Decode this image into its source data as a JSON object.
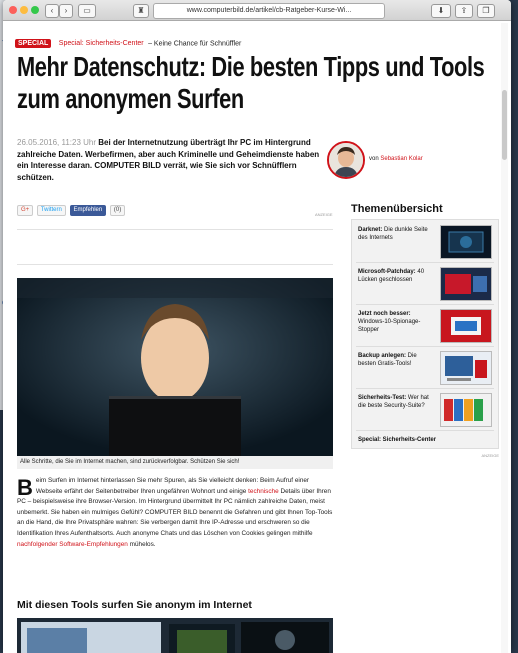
{
  "browser": {
    "url": "www.computerbild.de/artikel/cb-Ratgeber-Kurse-Wi..."
  },
  "background_window": {
    "cut_text": "Yo",
    "cut_text2": "CB"
  },
  "page": {
    "special_badge": "SPECIAL",
    "special_link": "Special: Sicherheits-Center",
    "special_suffix": "– Keine Chance für Schnüffler",
    "title": "Mehr Datenschutz: Die besten Tipps und Tools zum anonymen Surfen",
    "date": "26.05.2016, 11:23 Uhr",
    "lead": "Bei der Internetnutzung überträgt Ihr PC im Hintergrund zahlreiche Daten. Werbefirmen, aber auch Kriminelle und Geheimdienste haben ein Interesse daran. COMPUTER BILD verrät, wie Sie sich vor Schnüfflern schützen.",
    "author_prefix": "von",
    "author_name": "Sebastian Kolar",
    "social": {
      "gplus": "G+",
      "twitter": "Twittern",
      "facebook": "Empfehlen",
      "count": "(0)"
    },
    "ad_label": "ANZEIGE",
    "image_caption": "Alle Schritte, die Sie im Internet machen, sind zurückverfolgbar. Schützen Sie sich!",
    "body_drop": "B",
    "body_part1": "eim Surfen im Internet hinterlassen Sie mehr Spuren, als Sie vielleicht denken: Beim Aufruf einer Webseite erfährt der Seitenbetreiber Ihren ungefähren Wohnort und einige ",
    "body_link1": "technische",
    "body_part2": " Details über Ihren PC – beispielsweise ihre Browser-Version. Im Hintergrund übermittelt Ihr PC nämlich zahlreiche Daten, meist unbemerkt. Sie haben ein mulmiges Gefühl? COMPUTER BILD benennt die Gefahren und gibt Ihnen Top-Tools an die Hand, die Ihre Privatsphäre wahren: Sie verbergen damit Ihre IP-Adresse und erschweren so die Identifikation Ihres Aufenthaltsorts. Auch anonyme Chats und das Löschen von Cookies gelingen mithilfe ",
    "body_link2": "nachfolgender Software-Empfehlungen",
    "body_part3": " mühelos.",
    "subheading": "Mit diesen Tools surfen Sie anonym im Internet"
  },
  "sidebar": {
    "heading": "Themenübersicht",
    "items": [
      {
        "bold": "Darknet:",
        "text": " Die dunkle Seite des Internets"
      },
      {
        "bold": "Microsoft-Patchday:",
        "text": " 40 Lücken geschlossen"
      },
      {
        "bold": "Jetzt noch besser:",
        "text": " Windows-10-Spionage-Stopper"
      },
      {
        "bold": "Backup anlegen:",
        "text": " Die besten Gratis-Tools!"
      },
      {
        "bold": "Sicherheits-Test:",
        "text": " Wer hat die beste Security-Suite?"
      }
    ],
    "footer": "Special: Sicherheits-Center",
    "ad_label": "ANZEIGE"
  },
  "colors": {
    "accent": "#d01219"
  }
}
